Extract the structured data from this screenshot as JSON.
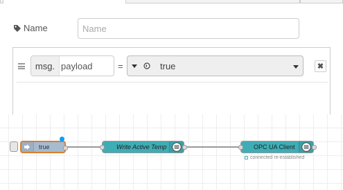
{
  "dialog": {
    "name_label": "Name",
    "name_value": "",
    "name_placeholder": "Name",
    "rule": {
      "property_prefix": "msg.",
      "property_value": "payload",
      "operator": "=",
      "value_type_icon": "boolean-type-icon",
      "value": "true",
      "delete_label": "✖"
    }
  },
  "flow": {
    "nodes": [
      {
        "type": "inject",
        "label": "true",
        "icon": "arrow-in-icon",
        "changed": true
      },
      {
        "type": "function",
        "label": "Write Active Temp",
        "icon": "opcua-icon"
      },
      {
        "type": "opcua-client",
        "label": "OPC UA Client",
        "icon": "opcua-icon",
        "status": "connected re-established"
      }
    ],
    "colors": {
      "inject_fill": "#a6bbcf",
      "selected_border": "#d97f2f",
      "opc_fill": "#3fadb5",
      "changed_dot": "#00a0ff"
    }
  }
}
